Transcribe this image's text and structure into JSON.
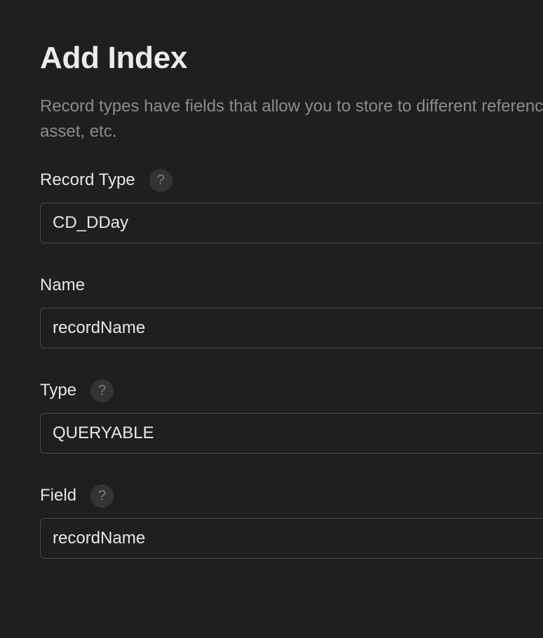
{
  "dialog": {
    "title": "Add Index",
    "description": "Record types have fields that allow you to store to different reference, asset, etc."
  },
  "fields": [
    {
      "label": "Record Type",
      "value": "CD_DDay",
      "has_help": true
    },
    {
      "label": "Name",
      "value": "recordName",
      "has_help": false
    },
    {
      "label": "Type",
      "value": "QUERYABLE",
      "has_help": true
    },
    {
      "label": "Field",
      "value": "recordName",
      "has_help": true
    }
  ],
  "help_icon_glyph": "?",
  "icons": {
    "help": "question-mark-icon"
  },
  "colors": {
    "background": "#1f1f1f",
    "text_primary": "#e8e8e8",
    "text_muted": "#8c8c8c",
    "field_border": "#4a4a4a",
    "help_icon_bg": "#343434"
  }
}
